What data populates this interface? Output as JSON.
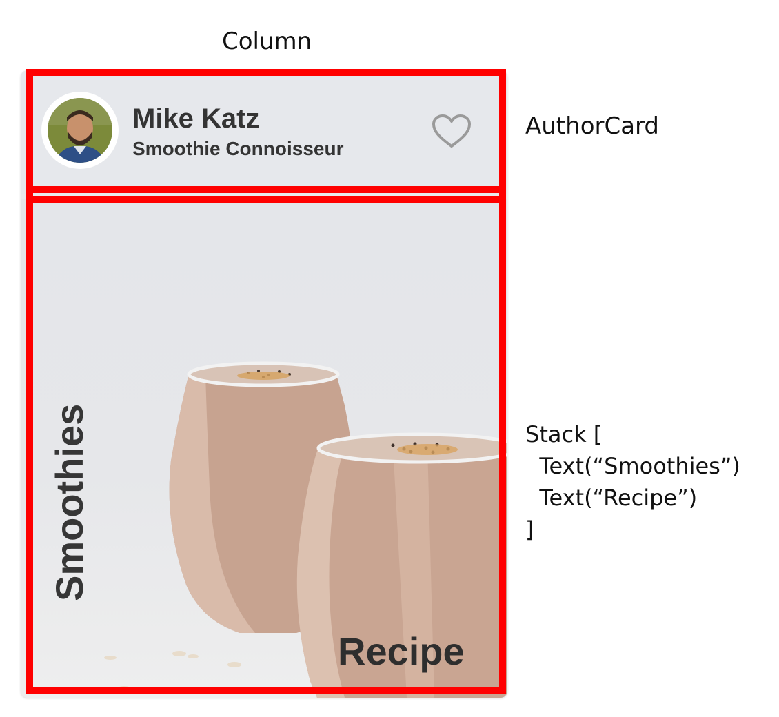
{
  "annotations": {
    "column": "Column",
    "author_card": "AuthorCard",
    "stack": "Stack [\n  Text(“Smoothies”)\n  Text(“Recipe”)\n]"
  },
  "author": {
    "name": "Mike Katz",
    "title": "Smoothie Connoisseur"
  },
  "stack": {
    "vertical_text": "Smoothies",
    "corner_text": "Recipe"
  },
  "icons": {
    "favorite": "heart-outline-icon",
    "avatar": "author-avatar"
  },
  "colors": {
    "frame": "#ff0000",
    "card_background": "#e6e8ec",
    "text": "#343434",
    "heart": "#9a9a9a"
  }
}
